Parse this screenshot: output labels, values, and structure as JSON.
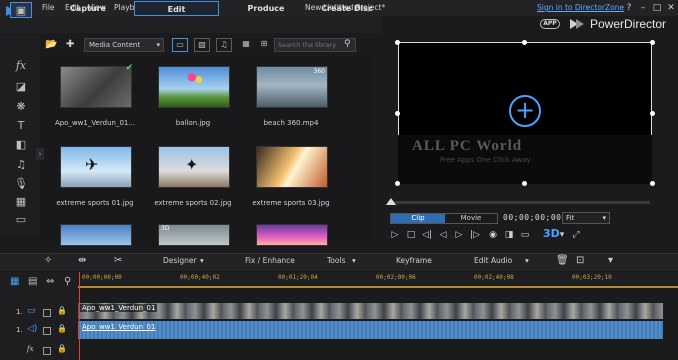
{
  "menu": [
    "File",
    "Edit",
    "View",
    "Playback"
  ],
  "project_title": "New Untitled Project*",
  "signin_text": "Sign in to DirectorZone",
  "brand": "PowerDirector",
  "app_badge": "APP",
  "mode_tabs": [
    "Capture",
    "Edit",
    "Produce",
    "Create Disc"
  ],
  "library": {
    "filter": "Media Content",
    "search_placeholder": "Search the library",
    "items": [
      {
        "label": "Apo_ww1_Verdun_01..."
      },
      {
        "label": "ballon.jpg"
      },
      {
        "label": "beach 360.mp4"
      },
      {
        "label": "extreme sports 01.jpg"
      },
      {
        "label": "extreme sports 02.jpg"
      },
      {
        "label": "extreme sports 03.jpg"
      }
    ],
    "badge_360": "360",
    "badge_3d": "3D"
  },
  "preview": {
    "watermark": "ALL PC World",
    "watermark_sub": "Free Apps One Click Away",
    "clip_label": "Clip",
    "movie_label": "Movie",
    "timecode": "00;00;00;00",
    "fit": "Fit",
    "btn_3d": "3D"
  },
  "edit_toolbar": {
    "designer": "Designer",
    "fix_enhance": "Fix / Enhance",
    "tools": "Tools",
    "keyframe": "Keyframe",
    "edit_audio": "Edit Audio"
  },
  "timeline": {
    "ticks": [
      "00;00;00;00",
      "00;00;40;02",
      "00;01;20;04",
      "00;02;00;06",
      "00;02;40;08",
      "00;03;20;10"
    ],
    "track1_video": "1.",
    "track1_audio": "1.",
    "video_clip": "Apo_ww1_Verdun_01",
    "audio_clip": "Apo_ww1_Verdun_01",
    "fx": "fx"
  }
}
